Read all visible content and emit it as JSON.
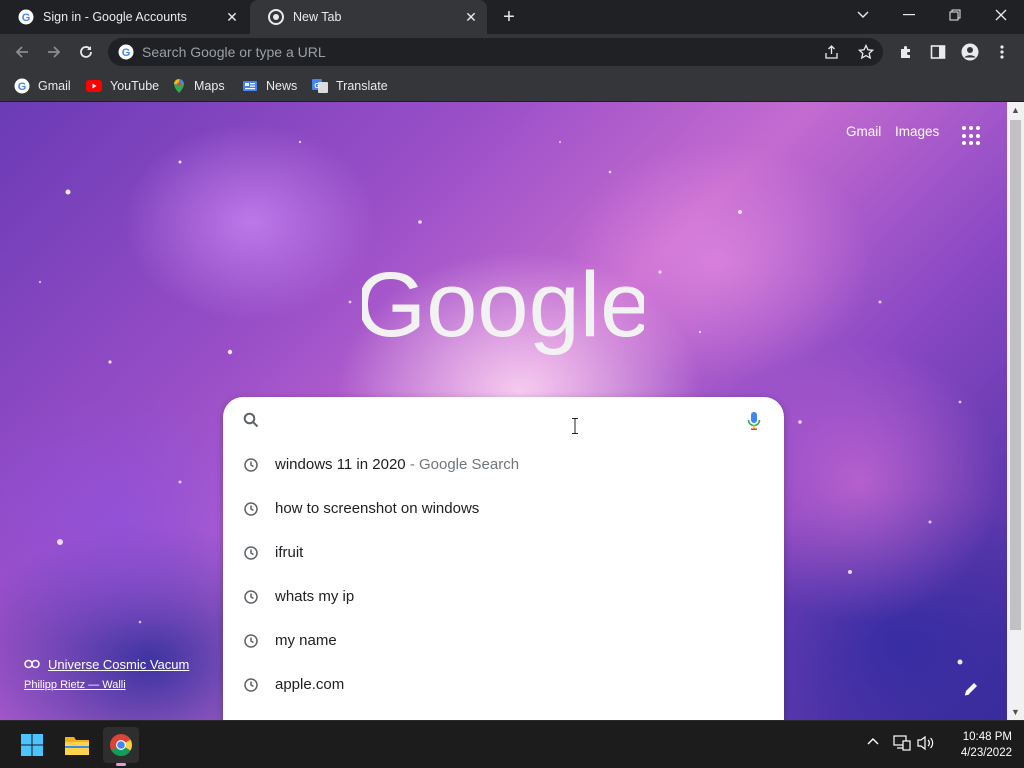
{
  "tabs": [
    {
      "title": "Sign in - Google Accounts",
      "icon": "google-g-icon",
      "active": false
    },
    {
      "title": "New Tab",
      "icon": "chrome-icon",
      "active": true
    }
  ],
  "omnibox": {
    "placeholder": "Search Google or type a URL"
  },
  "bookmarks": [
    {
      "label": "Gmail",
      "icon": "google-g-icon"
    },
    {
      "label": "YouTube",
      "icon": "youtube-icon"
    },
    {
      "label": "Maps",
      "icon": "maps-icon"
    },
    {
      "label": "News",
      "icon": "news-icon"
    },
    {
      "label": "Translate",
      "icon": "translate-icon"
    }
  ],
  "ntp": {
    "gmail_link": "Gmail",
    "images_link": "Images",
    "logo_text": "Google"
  },
  "suggestions": [
    {
      "text": "windows 11 in 2020",
      "suffix": " - Google Search"
    },
    {
      "text": "how to screenshot on windows",
      "suffix": ""
    },
    {
      "text": "ifruit",
      "suffix": ""
    },
    {
      "text": "whats my ip",
      "suffix": ""
    },
    {
      "text": "my name",
      "suffix": ""
    },
    {
      "text": "apple.com",
      "suffix": ""
    }
  ],
  "background_credit": {
    "title": "Universe Cosmic Vacum",
    "author": "Philipp Rietz — Walli"
  },
  "taskbar": {
    "time": "10:48 PM",
    "date": "4/23/2022"
  }
}
